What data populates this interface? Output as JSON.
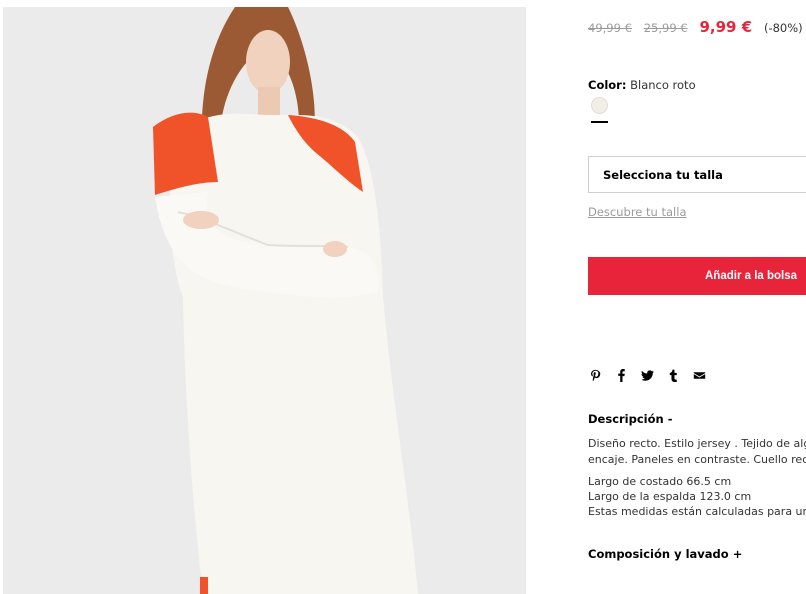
{
  "product": {
    "prices": {
      "original": "49,99 €",
      "previous": "25,99 €",
      "current": "9,99 €",
      "discount": "(-80%)"
    },
    "color": {
      "label": "Color:",
      "value": "Blanco roto",
      "swatch_hex": "#f1eee8"
    },
    "size": {
      "select_label": "Selecciona tu talla",
      "guide_link": "Descubre tu talla"
    },
    "add_button": "Añadir a la bolsa",
    "share_icons": [
      "pinterest-icon",
      "facebook-icon",
      "twitter-icon",
      "tumblr-icon",
      "email-icon"
    ],
    "description": {
      "title": "Descripción -",
      "lines": [
        "Diseño recto. Estilo jersey . Tejido de algo",
        "encaje. Paneles en contraste. Cuello redon"
      ],
      "measures": [
        "Largo de costado 66.5 cm",
        "Largo de la espalda 123.0 cm",
        "Estas medidas están calculadas para una"
      ]
    },
    "composition_title": "Composición y lavado +"
  },
  "colors": {
    "accent": "#e8243a",
    "muted": "#9b9b9b",
    "panel_orange": "#f0532a"
  }
}
